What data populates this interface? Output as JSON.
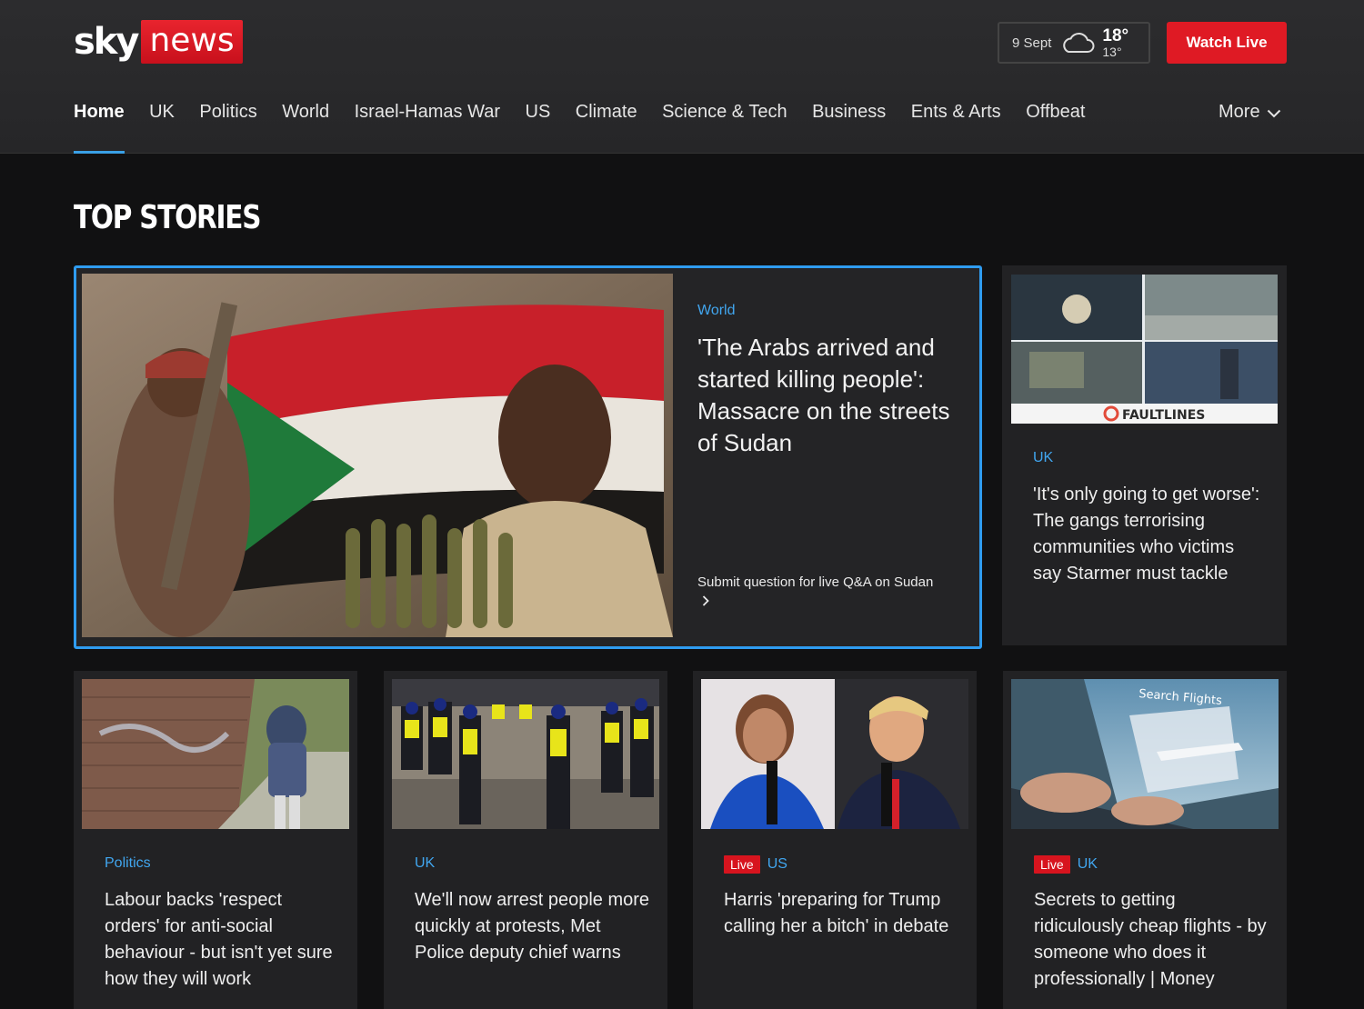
{
  "header": {
    "logo": {
      "sky": "sky",
      "news": "news"
    },
    "weather": {
      "date": "9 Sept",
      "high": "18°",
      "low": "13°",
      "icon": "cloud-icon"
    },
    "watch_live": "Watch Live"
  },
  "nav": {
    "items": [
      "Home",
      "UK",
      "Politics",
      "World",
      "Israel-Hamas War",
      "US",
      "Climate",
      "Science & Tech",
      "Business",
      "Ents & Arts",
      "Offbeat"
    ],
    "active": "Home",
    "more": "More"
  },
  "section_title": "TOP STORIES",
  "hero": {
    "category": "World",
    "headline": "'The Arabs arrived and started killing people': Massacre on the streets of Sudan",
    "sub_link": "Submit question for live Q&A on Sudan"
  },
  "side_story": {
    "category": "UK",
    "headline": "'It's only going to get worse': The gangs terrorising communities who victims say Starmer must tackle",
    "image_brand": "FAULTLINES"
  },
  "stories": [
    {
      "category": "Politics",
      "live": "",
      "headline": "Labour backs 'respect orders' for anti-social behaviour - but isn't yet sure how they will work"
    },
    {
      "category": "UK",
      "live": "",
      "headline": "We'll now arrest people more quickly at protests, Met Police deputy chief warns"
    },
    {
      "category": "US",
      "live": "Live",
      "headline": "Harris 'preparing for Trump calling her a bitch' in debate"
    },
    {
      "category": "UK",
      "live": "Live",
      "headline": "Secrets to getting ridiculously cheap flights - by someone who does it professionally | Money",
      "image_text": "Search Flights"
    }
  ],
  "colors": {
    "accent_blue": "#41a6ef",
    "brand_red": "#df1a24",
    "background": "#111112"
  }
}
